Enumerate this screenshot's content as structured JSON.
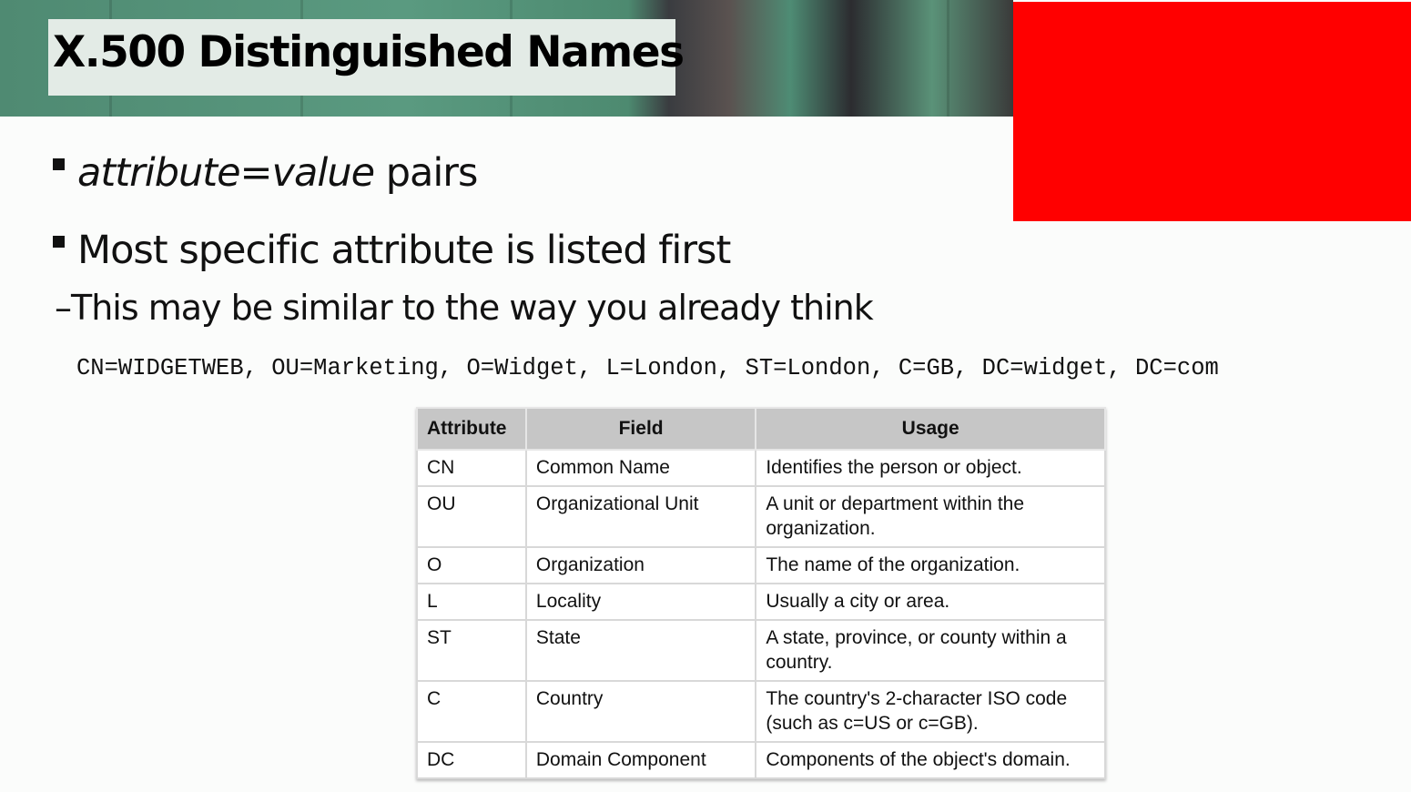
{
  "slide": {
    "title": "X.500 Distinguished Names",
    "bullets": [
      {
        "italic": "attribute=value",
        "text": " pairs"
      },
      {
        "text": "Most specific attribute is listed first"
      }
    ],
    "sub_bullet": "This may be similar to the way you already think",
    "sub_bullet_marker": "–",
    "example_dn": "CN=WIDGETWEB, OU=Marketing, O=Widget, L=London, ST=London, C=GB, DC=widget, DC=com",
    "redaction_color": "#ff0000"
  },
  "table": {
    "headers": [
      "Attribute",
      "Field",
      "Usage"
    ],
    "rows": [
      [
        "CN",
        "Common Name",
        "Identifies the person or object."
      ],
      [
        "OU",
        "Organizational Unit",
        "A unit or department within the organization."
      ],
      [
        "O",
        "Organization",
        "The name of the organization."
      ],
      [
        "L",
        "Locality",
        "Usually a city or area."
      ],
      [
        "ST",
        "State",
        "A state, province, or county within a country."
      ],
      [
        "C",
        "Country",
        "The country's 2-character ISO code (such as c=US or c=GB)."
      ],
      [
        "DC",
        "Domain Component",
        "Components of the object's domain."
      ]
    ]
  }
}
